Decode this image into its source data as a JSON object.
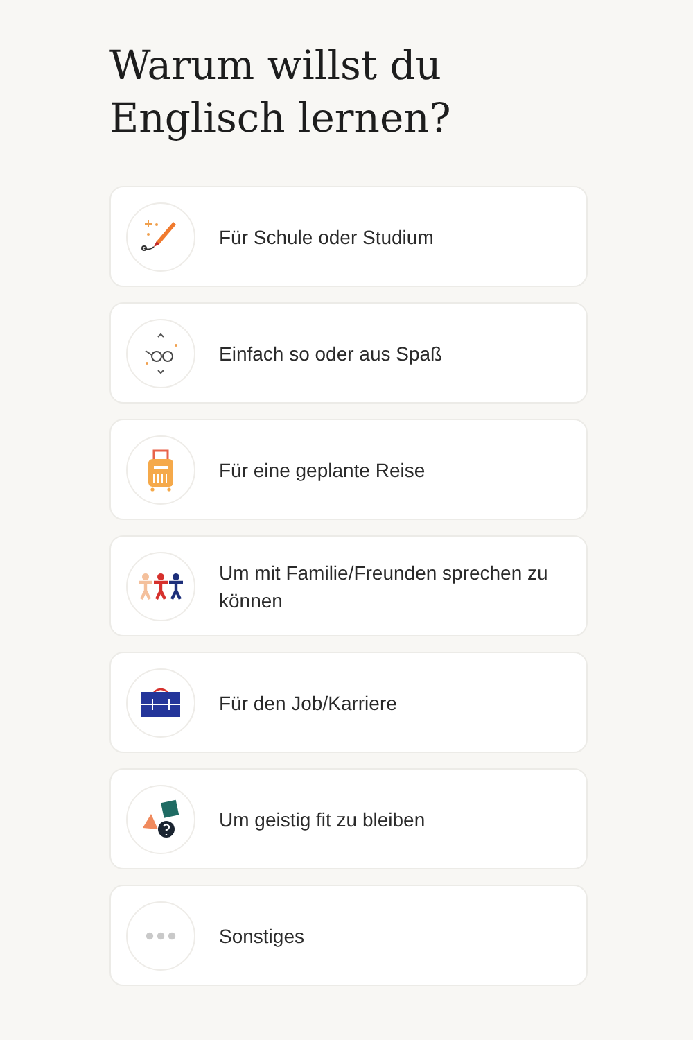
{
  "title": "Warum willst du Englisch lernen?",
  "options": [
    {
      "kind": "pencil",
      "label": "Für Schule oder Studium"
    },
    {
      "kind": "glasses",
      "label": "Einfach so oder aus Spaß"
    },
    {
      "kind": "suitcase",
      "label": "Für eine geplante Reise"
    },
    {
      "kind": "people",
      "label": "Um mit Familie/Freunden sprechen zu können"
    },
    {
      "kind": "briefcase",
      "label": "Für den Job/Karriere"
    },
    {
      "kind": "shapes",
      "label": "Um geistig fit zu bleiben"
    },
    {
      "kind": "dots",
      "label": "Sonstiges"
    }
  ]
}
